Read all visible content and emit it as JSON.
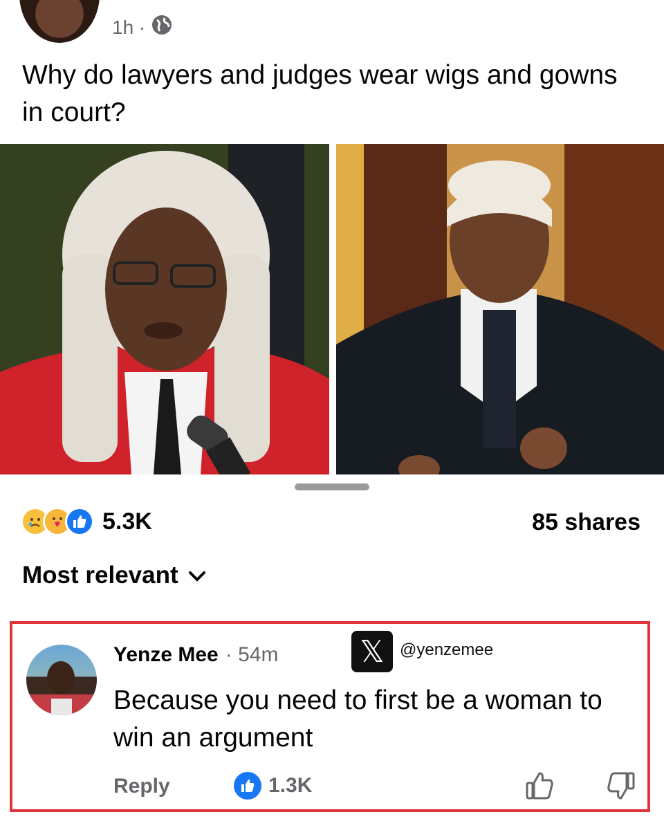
{
  "post": {
    "time": "1h ·",
    "text": "Why do lawyers and judges wear wigs and gowns in court?",
    "reaction_count": "5.3K",
    "shares": "85 shares"
  },
  "icons": {
    "privacy": "globe-icon",
    "reactions": [
      "sad-face-icon",
      "care-face-icon",
      "like-thumb-icon"
    ]
  },
  "sort": {
    "label": "Most relevant"
  },
  "comment": {
    "author": "Yenze Mee",
    "time": "· 54m",
    "watermark_handle": "@yenzemee",
    "text": "Because you need to first be a woman to win an argument",
    "reply_label": "Reply",
    "likes": "1.3K"
  },
  "colors": {
    "facebook_blue": "#1877f2",
    "highlight_border": "#e0343a",
    "meta_text": "#65676b"
  }
}
